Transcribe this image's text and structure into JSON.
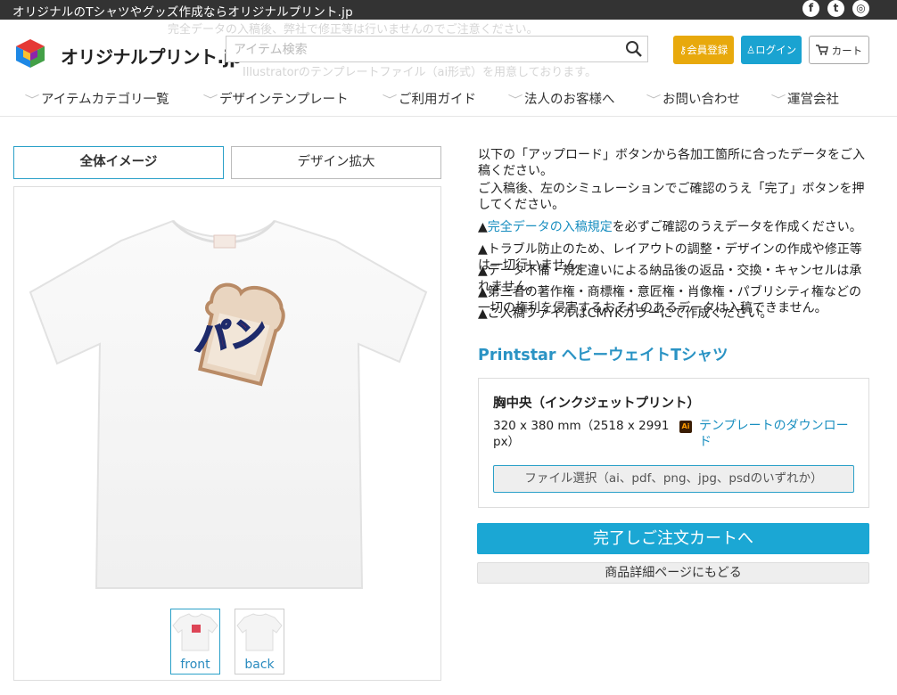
{
  "topbar": {
    "tagline": "オリジナルのTシャツやグッズ作成ならオリジナルプリント.jp",
    "social": [
      {
        "icon": "facebook-icon",
        "glyph": "f"
      },
      {
        "icon": "twitter-icon",
        "glyph": "t"
      },
      {
        "icon": "instagram-icon",
        "glyph": "◎"
      }
    ]
  },
  "header": {
    "logo_text": "オリジナルプリント.jp",
    "search_placeholder": "アイテム検索",
    "register_label": "会員登録",
    "login_label": "ログイン",
    "cart_label": "カート",
    "ghost_lines": [
      "完全データの入稿後、弊社で修正等は行いませんのでご注意ください。",
      "Illustratorのテンプレートファイル（ai形式）を用意しております。"
    ]
  },
  "nav": [
    "アイテムカテゴリ一覧",
    "デザインテンプレート",
    "ご利用ガイド",
    "法人のお客様へ",
    "お問い合わせ",
    "運営会社"
  ],
  "tabs": {
    "overall": "全体イメージ",
    "zoom": "デザイン拡大"
  },
  "preview": {
    "design_text": "パン",
    "thumbs": [
      {
        "label": "front",
        "selected": true
      },
      {
        "label": "back",
        "selected": false
      }
    ]
  },
  "instructions": {
    "intro1": "以下の「アップロード」ボタンから各加工箇所に合ったデータをご入稿ください。",
    "intro2": "ご入稿後、左のシミュレーションでご確認のうえ「完了」ボタンを押してください。",
    "link_text": "完全データの入稿規定",
    "link_suffix": "を必ずご確認のうえデータを作成ください。",
    "notes": [
      "トラブル防止のため、レイアウトの調整・デザインの作成や修正等は一切行いません。",
      "データ不備・規定違いによる納品後の返品・交換・キャンセルは承れません。",
      "第三者の著作権・商標権・意匠権・肖像権・パブリシティ権などの一切の権利を侵害するおそれのあるデータは入稿できません。",
      "ご入稿ファイルはCMYKカラーにて作成ください。"
    ],
    "warn_glyph": "▲"
  },
  "product": {
    "name": "Printstar ヘビーウェイトTシャツ",
    "location_title": "胸中央（インクジェットプリント）",
    "dimensions": "320 x 380 mm（2518 x 2991 px）",
    "template_link": "テンプレートのダウンロード",
    "file_button": "ファイル選択（ai、pdf、png、jpg、psdのいずれか）"
  },
  "actions": {
    "complete": "完了しご注文カートへ",
    "back": "商品詳細ページにもどる"
  },
  "colors": {
    "accent": "#1ba7d4",
    "register": "#e8a90c",
    "topbar": "#333333"
  }
}
